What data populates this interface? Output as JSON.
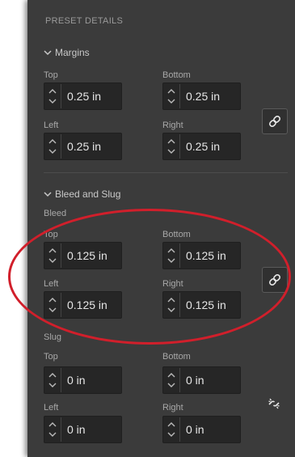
{
  "panel": {
    "title": "PRESET DETAILS"
  },
  "margins": {
    "section_label": "Margins",
    "top_label": "Top",
    "top_value": "0.25 in",
    "bottom_label": "Bottom",
    "bottom_value": "0.25 in",
    "left_label": "Left",
    "left_value": "0.25 in",
    "right_label": "Right",
    "right_value": "0.25 in"
  },
  "bleed_slug": {
    "section_label": "Bleed and Slug"
  },
  "bleed": {
    "group_label": "Bleed",
    "top_label": "Top",
    "top_value": "0.125 in",
    "bottom_label": "Bottom",
    "bottom_value": "0.125 in",
    "left_label": "Left",
    "left_value": "0.125 in",
    "right_label": "Right",
    "right_value": "0.125 in"
  },
  "slug": {
    "group_label": "Slug",
    "top_label": "Top",
    "top_value": "0 in",
    "bottom_label": "Bottom",
    "bottom_value": "0 in",
    "left_label": "Left",
    "left_value": "0 in",
    "right_label": "Right",
    "right_value": "0 in"
  },
  "icons": {
    "section_toggle": "chevron-down-icon",
    "stepper": "stepper-arrows-icon",
    "linked": "chain-link-icon",
    "unlinked": "broken-chain-link-icon"
  },
  "colors": {
    "panel_bg": "#3b3b3b",
    "field_bg": "#262626",
    "annotation": "#d11f2b"
  }
}
